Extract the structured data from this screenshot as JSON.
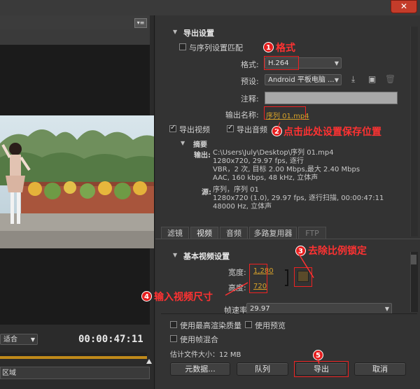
{
  "window": {
    "close_label": "✕"
  },
  "preview": {
    "fit_select": "适合",
    "timecode": "00:00:47:11",
    "source_range": "区域"
  },
  "export_settings": {
    "section_title": "导出设置",
    "match_sequence_label": "与序列设置匹配",
    "format_label": "格式:",
    "format_value": "H.264",
    "preset_label": "预设:",
    "preset_value": "Android 平板电脑 ...",
    "comment_label": "注释:",
    "output_name_label": "输出名称:",
    "output_name_value": "序列 01.mp4",
    "export_video_label": "导出视频",
    "export_audio_label": "导出音频"
  },
  "summary": {
    "title": "摘要",
    "output_label": "输出:",
    "output_lines": [
      "C:\\Users\\July\\Desktop\\序列 01.mp4",
      "1280x720, 29.97 fps, 逐行",
      "VBR，2 次, 目标 2.00 Mbps,最大 2.40 Mbps",
      "AAC, 160 kbps, 48 kHz, 立体声"
    ],
    "source_label": "源:",
    "source_lines": [
      "序列，序列 01",
      "1280x720 (1.0), 29.97 fps, 逐行扫描, 00:00:47:11",
      "48000 Hz, 立体声"
    ]
  },
  "tabs": [
    "滤镜",
    "视频",
    "音频",
    "多路复用器",
    "FTP"
  ],
  "video_settings": {
    "section_title": "基本视频设置",
    "width_label": "宽度:",
    "width_value": "1,280",
    "height_label": "高度:",
    "height_value": "720",
    "framerate_label": "帧速率:",
    "framerate_value": "29.97"
  },
  "options": {
    "max_render_quality": "使用最高渲染质量",
    "use_preview": "使用预览",
    "frame_blending": "使用帧混合",
    "estimated_size": "估计文件大小：12 MB"
  },
  "buttons": {
    "metadata": "元数据...",
    "queue": "队列",
    "export": "导出",
    "cancel": "取消"
  },
  "annotations": {
    "a1_num": "1",
    "a1_text": "格式",
    "a2_num": "2",
    "a2_text": "点击此处设置保存位置",
    "a3_num": "3",
    "a3_text": "去除比例锁定",
    "a4_num": "4",
    "a4_text": "输入视频尺寸",
    "a5_num": "5"
  },
  "colors": {
    "annotation_red": "#ff3232",
    "value_gold": "#d8a229",
    "timeline_orange": "#c08a1a"
  }
}
